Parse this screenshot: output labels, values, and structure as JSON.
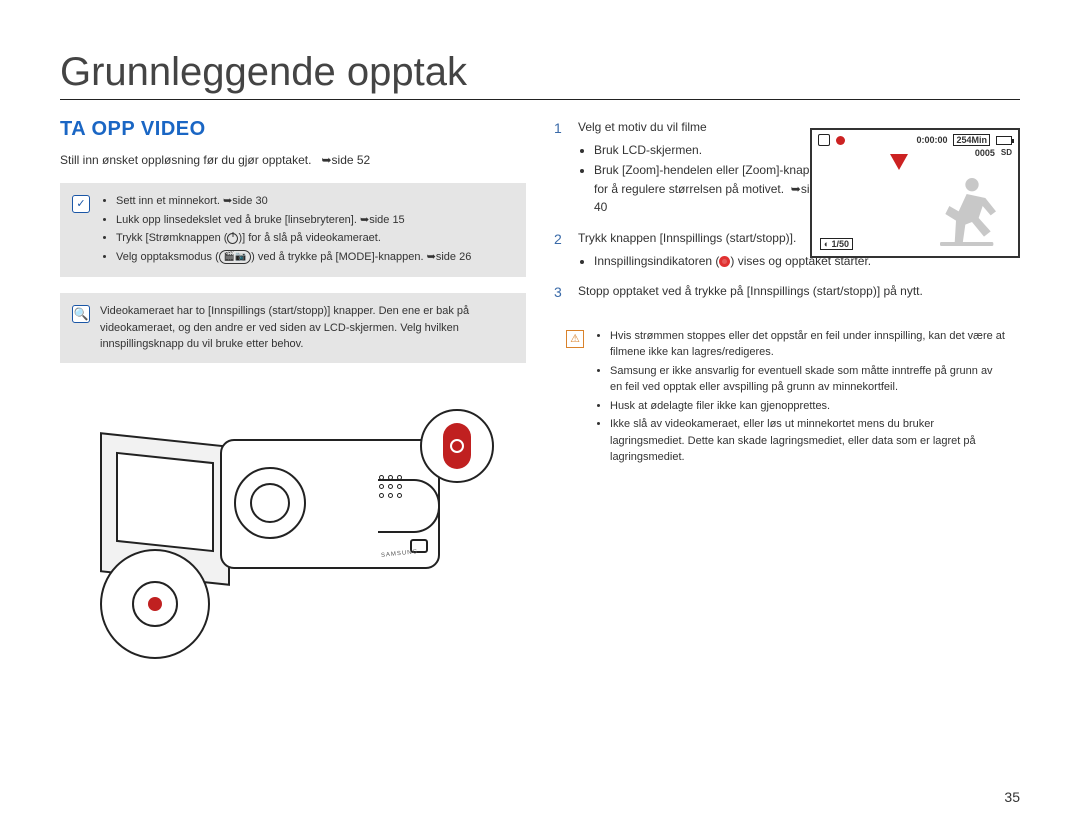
{
  "page": {
    "title": "Grunnleggende opptak",
    "number": "35"
  },
  "section": {
    "heading": "TA OPP VIDEO",
    "intro": "Still inn ønsket oppløsning før du gjør opptaket.",
    "intro_ref": "side 52"
  },
  "tipbox": {
    "items": [
      "Sett inn et minnekort.",
      "Lukk opp linsedekslet ved å bruke [linsebryteren].",
      "Trykk [Strømknappen ( )] for å slå på videokameraet.",
      "Velg opptaksmodus ( ) ved å trykke på [MODE]-knappen."
    ],
    "refs": {
      "0": "side 30",
      "1": "side 15",
      "3": "side 26"
    }
  },
  "notebox": {
    "text": "Videokameraet har to [Innspillings (start/stopp)] knapper. Den ene er bak på videokameraet, og den andre er ved siden av LCD-skjermen. Velg hvilken innspillingsknapp du vil bruke etter behov."
  },
  "steps": {
    "s1": {
      "num": "1",
      "text": "Velg et motiv du vil filme",
      "bullets": [
        "Bruk LCD-skjermen.",
        "Bruk [Zoom]-hendelen eller [Zoom]-knappen for å regulere størrelsen på motivet."
      ],
      "ref": "side 40"
    },
    "s2": {
      "num": "2",
      "text": "Trykk knappen [Innspillings (start/stopp)].",
      "bullets": [
        "Innspillingsindikatoren ( ) vises og opptaket starter."
      ]
    },
    "s3": {
      "num": "3",
      "text": "Stopp opptaket ved å trykke på [Innspillings (start/stopp)] på nytt."
    }
  },
  "warnbox": {
    "items": [
      "Hvis strømmen stoppes eller det oppstår en feil under innspilling, kan det være at filmene ikke kan lagres/redigeres.",
      "Samsung er ikke ansvarlig for eventuell skade som måtte inntreffe på grunn av en feil ved opptak eller avspilling på grunn av minnekortfeil.",
      "Husk at ødelagte filer ikke kan gjenopprettes.",
      "Ikke slå av videokameraet, eller løs ut minnekortet mens du bruker lagringsmediet. Dette kan skade lagringsmediet, eller data som er lagret på lagringsmediet."
    ]
  },
  "lcd": {
    "stby": "",
    "time": "0:00:00",
    "remaining": "254Min",
    "counter": "0005",
    "card": "SD",
    "shutter": "1/50"
  },
  "icons": {
    "check": "✓",
    "lens": "🔍",
    "warn": "⚠",
    "arrow": "➥",
    "video": "🎬",
    "camera": "📷",
    "aperture": "◐"
  }
}
